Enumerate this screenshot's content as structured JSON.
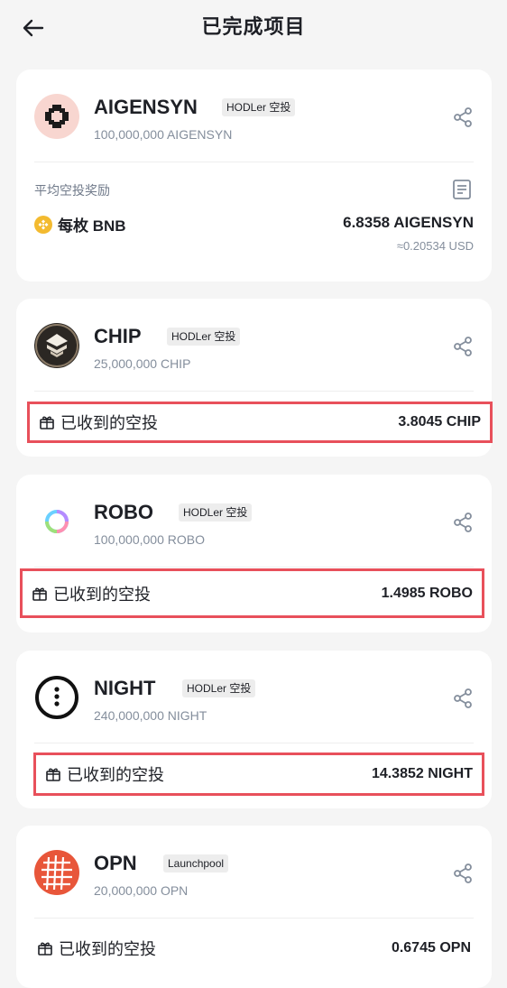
{
  "header": {
    "title": "已完成项目"
  },
  "projects": [
    {
      "name": "AIGENSYN",
      "tag": "HODLer 空投",
      "supply": "100,000,000 AIGENSYN",
      "avg_label": "平均空投奖励",
      "per_label": "每枚 BNB",
      "per_value": "6.8358 AIGENSYN",
      "per_usd": "≈0.20534 USD"
    },
    {
      "name": "CHIP",
      "tag": "HODLer 空投",
      "supply": "25,000,000 CHIP",
      "received_label": "已收到的空投",
      "received_value": "3.8045 CHIP"
    },
    {
      "name": "ROBO",
      "tag": "HODLer 空投",
      "supply": "100,000,000 ROBO",
      "received_label": "已收到的空投",
      "received_value": "1.4985 ROBO"
    },
    {
      "name": "NIGHT",
      "tag": "HODLer 空投",
      "supply": "240,000,000 NIGHT",
      "received_label": "已收到的空投",
      "received_value": "14.3852 NIGHT"
    },
    {
      "name": "OPN",
      "tag": "Launchpool",
      "supply": "20,000,000 OPN",
      "received_label": "已收到的空投",
      "received_value": "0.6745 OPN"
    }
  ],
  "colors": {
    "highlight_border": "#e8505b",
    "bnb": "#f3ba2f",
    "opn": "#e8563a"
  }
}
